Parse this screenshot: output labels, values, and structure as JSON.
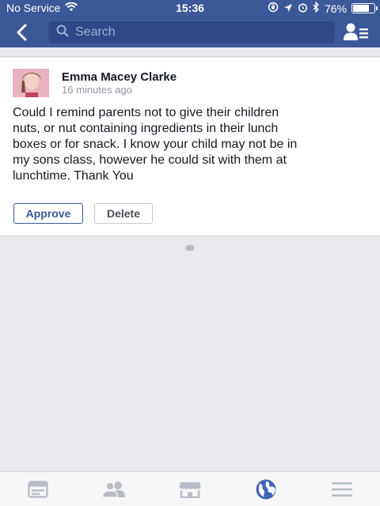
{
  "status": {
    "carrier": "No Service",
    "time": "15:36",
    "battery": "76%",
    "battery_level": 0.76
  },
  "nav": {
    "search_placeholder": "Search"
  },
  "post": {
    "author": "Emma Macey Clarke",
    "timestamp": "16 minutes ago",
    "lines": [
      "Could I remind parents not to give their children",
      "nuts, or nut containing ingredients in their lunch",
      "boxes or for snack. I know your child may not be in",
      "my sons class, however he could sit with them at",
      "lunchtime. Thank You"
    ],
    "approve_label": "Approve",
    "delete_label": "Delete"
  },
  "tabs": [
    {
      "icon": "news-feed-icon",
      "active": false
    },
    {
      "icon": "friends-icon",
      "active": false
    },
    {
      "icon": "marketplace-icon",
      "active": false
    },
    {
      "icon": "globe-notifications-icon",
      "active": true
    },
    {
      "icon": "menu-icon",
      "active": false
    }
  ],
  "colors": {
    "brand": "#3b5998",
    "active_tab": "#4267b2",
    "inactive_tab": "#b7bcc6"
  }
}
